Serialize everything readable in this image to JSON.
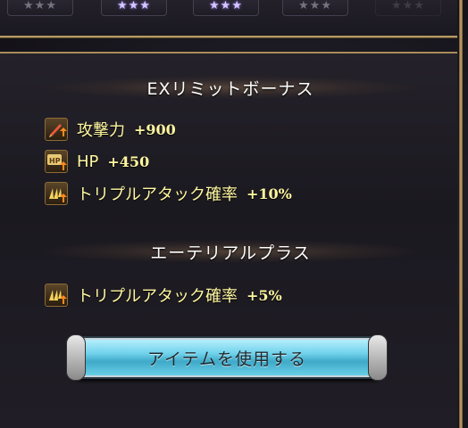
{
  "star_rows": [
    {
      "stars": "★★★",
      "state": "off"
    },
    {
      "stars": "★★★",
      "state": "on"
    },
    {
      "stars": "★★★",
      "state": "on"
    },
    {
      "stars": "★★★",
      "state": "off"
    },
    {
      "stars": "★★★",
      "state": "faint"
    }
  ],
  "ex_limit": {
    "title": "EXリミットボーナス",
    "bonuses": [
      {
        "icon": "attack-sword-up-icon",
        "label": "攻撃力",
        "value": "+900"
      },
      {
        "icon": "hp-up-icon",
        "label": "HP",
        "value": "+450"
      },
      {
        "icon": "triple-attack-up-icon",
        "label": "トリプルアタック確率",
        "value": "+10%"
      }
    ]
  },
  "ethereal": {
    "title": "エーテリアルプラス",
    "bonuses": [
      {
        "icon": "triple-attack-up-icon",
        "label": "トリプルアタック確率",
        "value": "+5%"
      }
    ]
  },
  "use_item_button": {
    "label": "アイテムを使用する"
  },
  "colors": {
    "bonus_text": "#fff7a0",
    "button_accent": "#6fd1ea",
    "frame_gold": "#b79a64"
  }
}
